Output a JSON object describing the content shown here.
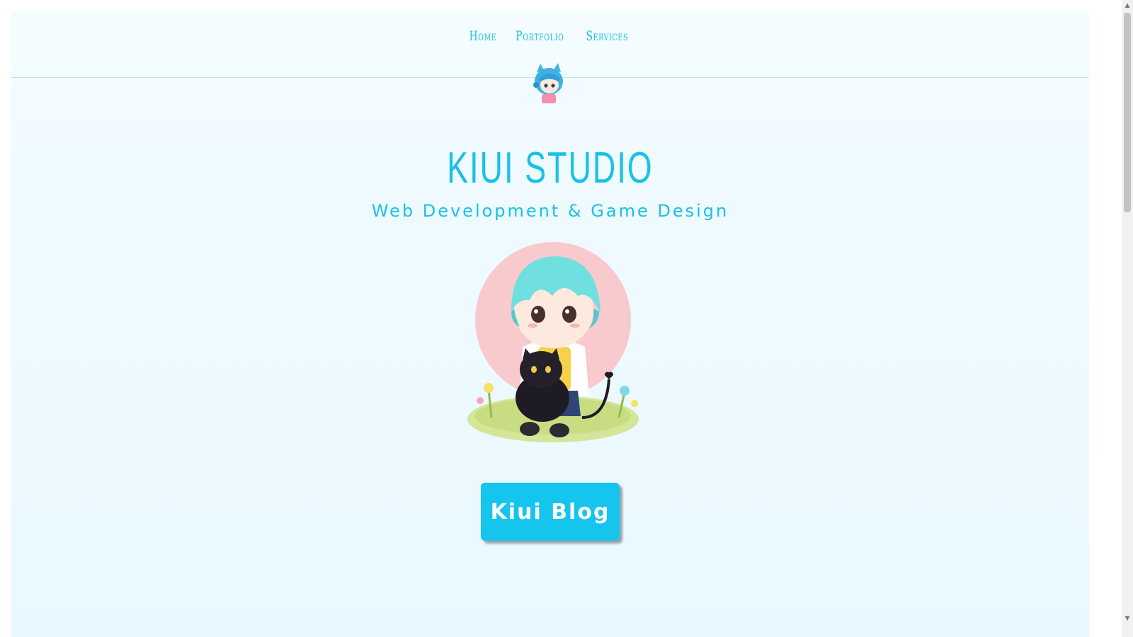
{
  "nav": {
    "items": [
      {
        "label": "Home"
      },
      {
        "label": "Portfolio"
      },
      {
        "label": "Services"
      }
    ]
  },
  "hero": {
    "title": "KIUI STUDIO",
    "subtitle": "Web Development & Game Design"
  },
  "cta": {
    "label": "Kiui Blog"
  },
  "colors": {
    "accent": "#16c5ee",
    "background": "#eefaff",
    "hero_circle": "#f8c9cd"
  }
}
